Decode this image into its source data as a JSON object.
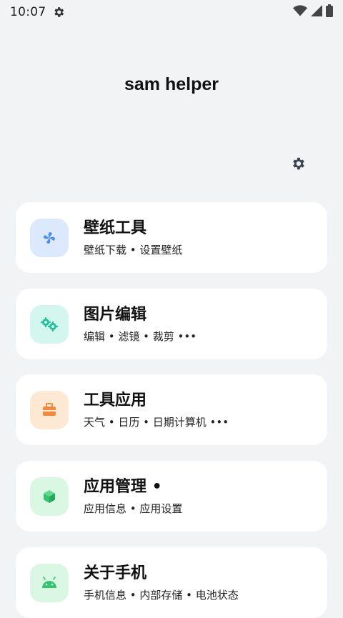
{
  "status_bar": {
    "time": "10:07",
    "gear_icon": "gear-icon",
    "wifi_icon": "wifi-icon",
    "signal_icon": "signal-icon",
    "battery_icon": "battery-icon"
  },
  "app": {
    "title": "sam helper",
    "settings_icon": "gear-icon"
  },
  "colors": {
    "background": "#f2f3f5",
    "card": "#ffffff",
    "blue_tile": "#dce8fb",
    "blue_icon": "#4f8fe6",
    "teal_tile": "#d3f6ee",
    "teal_icon": "#26bf9c",
    "orange_tile": "#fde8d3",
    "orange_icon": "#f08a3c",
    "green_tile": "#d9f7e2",
    "green_icon": "#34c46f"
  },
  "menu": {
    "items": [
      {
        "title": "壁纸工具",
        "subtitle": "壁纸下载 • 设置壁纸",
        "icon": "pinwheel-icon"
      },
      {
        "title": "图片编辑",
        "subtitle": "编辑 • 滤镜 • 裁剪 •••",
        "icon": "gears-icon"
      },
      {
        "title": "工具应用",
        "subtitle": "天气 • 日历 • 日期计算机 •••",
        "icon": "toolbox-icon"
      },
      {
        "title": "应用管理 •",
        "subtitle": "应用信息 • 应用设置",
        "icon": "cube-icon"
      },
      {
        "title": "关于手机",
        "subtitle": "手机信息 • 内部存储 • 电池状态",
        "icon": "android-icon"
      }
    ]
  }
}
